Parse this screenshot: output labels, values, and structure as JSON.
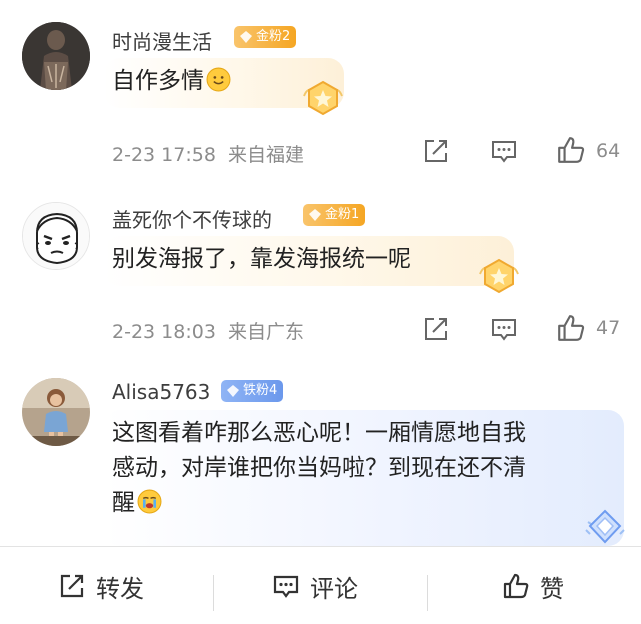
{
  "comments": [
    {
      "username": "时尚漫生活",
      "badge": "金粉2",
      "text": "自作多情",
      "emoji": "smile-emoji",
      "date": "2-23 17:58",
      "location": "来自福建",
      "likes": "64"
    },
    {
      "username": "盖死你个不传球的",
      "badge": "金粉1",
      "text": "别发海报了，靠发海报统一呢",
      "date": "2-23 18:03",
      "location": "来自广东",
      "likes": "47"
    },
    {
      "username": "Alisa5763",
      "badge": "铁粉4",
      "text_lines": [
        "这图看着咋那么恶心呢！一厢情愿地自我",
        "感动，对岸谁把你当妈啦？到现在还不清",
        "醒"
      ],
      "emoji": "crying-emoji"
    }
  ],
  "bottom_bar": {
    "repost": "转发",
    "comment": "评论",
    "like": "赞"
  },
  "colors": {
    "gold_badge": "#f5a623",
    "iron_badge": "#6b98ec",
    "meta_text": "#8c8c8c"
  }
}
